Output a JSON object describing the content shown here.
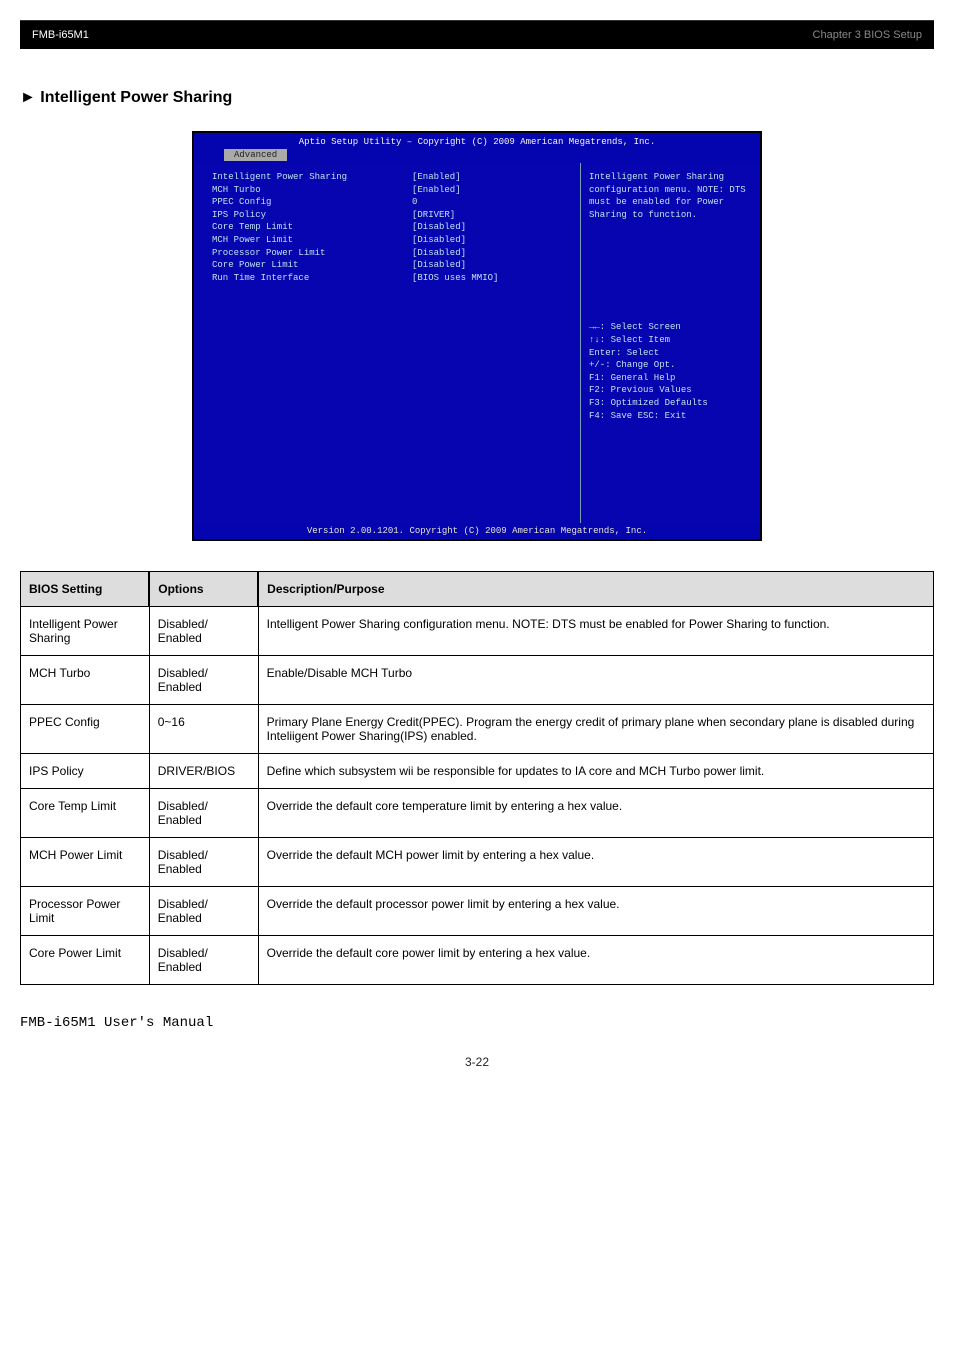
{
  "header": {
    "product": "FMB-i65M1",
    "chapter": "Chapter 3 BIOS Setup"
  },
  "section_title": "► Intelligent Power Sharing",
  "bios": {
    "title": "Aptio Setup Utility – Copyright (C) 2009 American Megatrends, Inc.",
    "tab_advanced": "Advanced",
    "rows": [
      {
        "label": "Intelligent Power Sharing",
        "value": "[Enabled]"
      },
      {
        "label": "MCH Turbo",
        "value": "[Enabled]"
      },
      {
        "label": "PPEC Config",
        "value": "0"
      },
      {
        "label": "IPS Policy",
        "value": "[DRIVER]"
      },
      {
        "label": "Core Temp Limit",
        "value": "[Disabled]"
      },
      {
        "label": "MCH Power Limit",
        "value": "[Disabled]"
      },
      {
        "label": "Processor Power Limit",
        "value": "[Disabled]"
      },
      {
        "label": "Core Power Limit",
        "value": "[Disabled]"
      },
      {
        "label": "Run Time Interface",
        "value": "[BIOS uses MMIO]"
      }
    ],
    "help_text": "Intelligent Power Sharing configuration menu.  NOTE: DTS must be enabled for Power Sharing to function.",
    "keys": [
      "→←: Select Screen",
      "↑↓: Select Item",
      "Enter: Select",
      "+/-: Change Opt.",
      "F1: General Help",
      "F2: Previous Values",
      "F3: Optimized Defaults",
      "F4: Save  ESC: Exit"
    ],
    "footer": "Version 2.00.1201. Copyright (C) 2009 American Megatrends, Inc."
  },
  "table": {
    "headers": [
      "BIOS Setting",
      "Options",
      "Description/Purpose"
    ],
    "rows": [
      {
        "c1": "Intelligent Power Sharing",
        "c2": "Disabled/ Enabled",
        "c3": "Intelligent Power Sharing configuration menu. NOTE: DTS must be enabled for Power Sharing to function."
      },
      {
        "c1": "MCH Turbo",
        "c2": "Disabled/ Enabled",
        "c3": "Enable/Disable MCH Turbo"
      },
      {
        "c1": "PPEC Config",
        "c2": "0~16",
        "c3": "Primary Plane Energy Credit(PPEC). Program the energy credit of primary plane when secondary plane is disabled during Inteliigent Power Sharing(IPS) enabled."
      },
      {
        "c1": "IPS Policy",
        "c2": "DRIVER/BIOS",
        "c3": "Define which subsystem wii be responsible for updates to IA core and MCH Turbo power limit."
      },
      {
        "c1": "Core Temp Limit",
        "c2": "Disabled/ Enabled",
        "c3": "Override the default core temperature limit by entering a hex value."
      },
      {
        "c1": "MCH Power Limit",
        "c2": "Disabled/ Enabled",
        "c3": "Override the default MCH power limit by entering a hex value."
      },
      {
        "c1": "Processor Power Limit",
        "c2": "Disabled/ Enabled",
        "c3": "Override the default processor power limit by entering a hex value."
      },
      {
        "c1": "Core Power Limit",
        "c2": "Disabled/ Enabled",
        "c3": "Override the default core power limit by entering a hex value."
      }
    ]
  },
  "breadcrumb": "FMB-i65M1 User's Manual",
  "page_number": "3-22"
}
